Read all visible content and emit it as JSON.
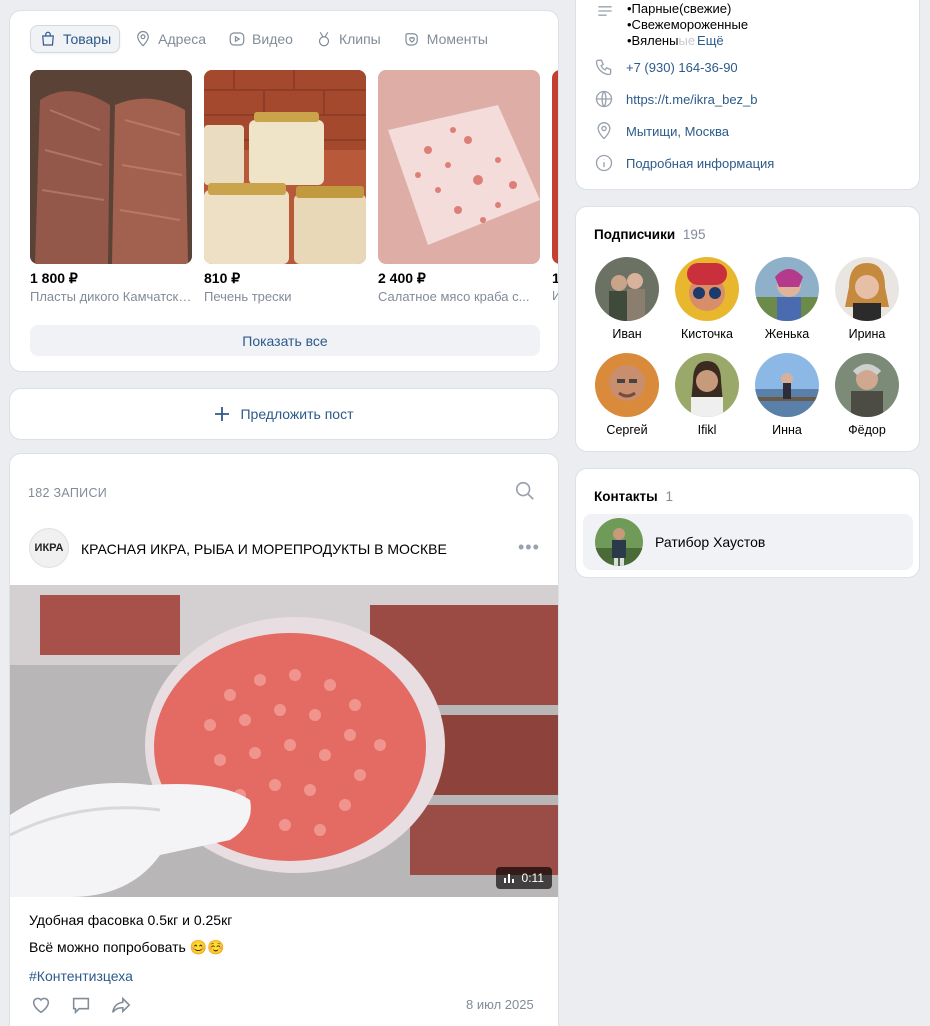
{
  "tabs": [
    {
      "label": "Товары",
      "icon": "bag-icon",
      "active": true
    },
    {
      "label": "Адреса",
      "icon": "location-icon"
    },
    {
      "label": "Видео",
      "icon": "video-icon"
    },
    {
      "label": "Клипы",
      "icon": "clips-icon"
    },
    {
      "label": "Моменты",
      "icon": "moments-icon"
    }
  ],
  "products": [
    {
      "price": "1 800 ₽",
      "name": "Пласты дикого Камчатского лосося"
    },
    {
      "price": "810 ₽",
      "name": "Печень трески"
    },
    {
      "price": "2 400 ₽",
      "name": "Салатное мясо краба с..."
    },
    {
      "price": "1",
      "name": "И"
    }
  ],
  "show_all": "Показать все",
  "suggest_post": "Предложить пост",
  "wall": {
    "count_label": "182 ЗАПИСИ",
    "author": "КРАСНАЯ ИКРА, РЫБА И МОРЕПРОДУКТЫ В МОСКВЕ",
    "author_logo_text": "ИКРА",
    "video_duration": "0:11",
    "text_line1": "Удобная фасовка 0.5кг и 0.25кг",
    "text_line2": "Всё можно попробовать 😊☺️",
    "hashtag": "#Контентизцеха",
    "date": "8 июл 2025"
  },
  "info": {
    "desc_lines": [
      "•Парные(свежие)",
      "•Свежемороженные",
      "•Вялены"
    ],
    "more": "Ещё",
    "phone": "+7 (930) 164-36-90",
    "link": "https://t.me/ikra_bez_b",
    "location": "Мытищи, Москва",
    "details": "Подробная информация"
  },
  "subscribers": {
    "title": "Подписчики",
    "count": "195",
    "people": [
      "Иван",
      "Кисточка",
      "Женька",
      "Ирина",
      "Сергей",
      "Ifikl",
      "Инна",
      "Фёдор"
    ]
  },
  "contacts": {
    "title": "Контакты",
    "count": "1",
    "people": [
      "Ратибор Хаустов"
    ]
  },
  "colors": {
    "accent": "#2c5a8a",
    "muted": "#818c99",
    "bg": "#ebedf0"
  }
}
